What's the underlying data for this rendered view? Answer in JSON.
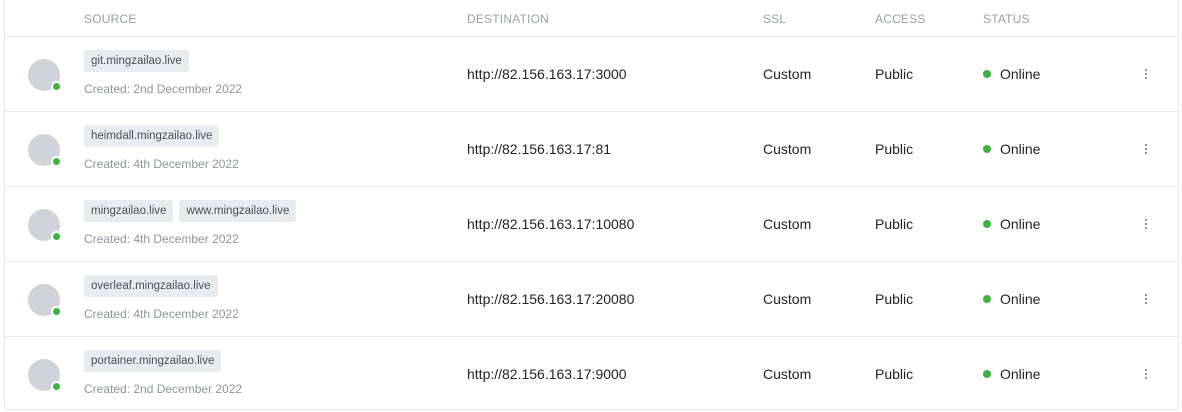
{
  "table": {
    "headers": {
      "source": "SOURCE",
      "destination": "DESTINATION",
      "ssl": "SSL",
      "access": "ACCESS",
      "status": "STATUS"
    },
    "rows": [
      {
        "tags": [
          "git.mingzailao.live"
        ],
        "created": "Created: 2nd December 2022",
        "destination": "http://82.156.163.17:3000",
        "ssl": "Custom",
        "access": "Public",
        "status": "Online"
      },
      {
        "tags": [
          "heimdall.mingzailao.live"
        ],
        "created": "Created: 4th December 2022",
        "destination": "http://82.156.163.17:81",
        "ssl": "Custom",
        "access": "Public",
        "status": "Online"
      },
      {
        "tags": [
          "mingzailao.live",
          "www.mingzailao.live"
        ],
        "created": "Created: 4th December 2022",
        "destination": "http://82.156.163.17:10080",
        "ssl": "Custom",
        "access": "Public",
        "status": "Online"
      },
      {
        "tags": [
          "overleaf.mingzailao.live"
        ],
        "created": "Created: 4th December 2022",
        "destination": "http://82.156.163.17:20080",
        "ssl": "Custom",
        "access": "Public",
        "status": "Online"
      },
      {
        "tags": [
          "portainer.mingzailao.live"
        ],
        "created": "Created: 2nd December 2022",
        "destination": "http://82.156.163.17:9000",
        "ssl": "Custom",
        "access": "Public",
        "status": "Online"
      }
    ]
  },
  "icons": {
    "avatar": "avatar-icon",
    "online_indicator": "online-dot-icon",
    "row_menu": "kebab-menu-icon"
  },
  "colors": {
    "online": "#3cb33c",
    "avatar": "#ced4da",
    "tag_bg": "#e8ebef",
    "header_text": "#9aa0a6"
  }
}
